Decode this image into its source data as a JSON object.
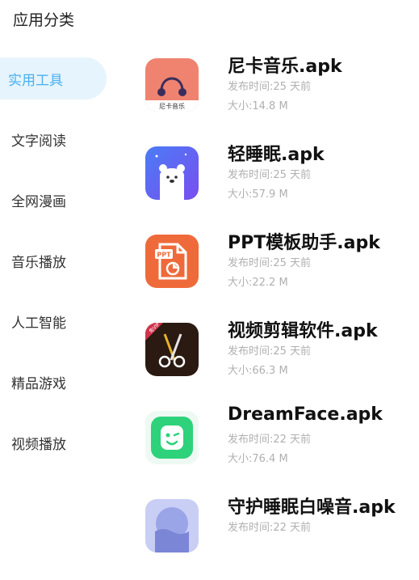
{
  "header": {
    "title": "应用分类"
  },
  "sidebar": {
    "items": [
      {
        "label": "实用工具",
        "active": true
      },
      {
        "label": "文字阅读"
      },
      {
        "label": "全网漫画"
      },
      {
        "label": "音乐播放"
      },
      {
        "label": "人工智能"
      },
      {
        "label": "精品游戏"
      },
      {
        "label": "视频播放"
      }
    ]
  },
  "apps": [
    {
      "name": "尼卡音乐.apk",
      "time": "发布时间:25 天前",
      "size": "大小:14.8 M",
      "icon": "nika-music-icon",
      "icon_text": "尼卡音乐",
      "color": "#f0836f"
    },
    {
      "name": "轻睡眠.apk",
      "time": "发布时间:25 天前",
      "size": "大小:57.9 M",
      "icon": "sleep-bear-icon",
      "color": "#5b67f0"
    },
    {
      "name": "PPT模板助手.apk",
      "time": "发布时间:25 天前",
      "size": "大小:22.2 M",
      "icon": "ppt-icon",
      "icon_text": "PPT",
      "color": "#ef6a3a"
    },
    {
      "name": "视频剪辑软件.apk",
      "time": "发布时间:25 天前",
      "size": "大小:66.3 M",
      "icon": "video-edit-icon",
      "icon_text": "免VIP",
      "color": "#2a1a12"
    },
    {
      "name": "DreamFace.apk",
      "time": "发布时间:22 天前",
      "size": "大小:76.4 M",
      "icon": "dreamface-icon",
      "color": "#2ed27a"
    },
    {
      "name": "守护睡眠白噪音.apk",
      "time": "发布时间:22 天前",
      "size": "",
      "icon": "white-noise-icon",
      "color": "#9aa5e8"
    }
  ],
  "colors": {
    "accent": "#49b1ef",
    "active_bg": "#e6f4fd",
    "meta_text": "#b0b0b0"
  }
}
